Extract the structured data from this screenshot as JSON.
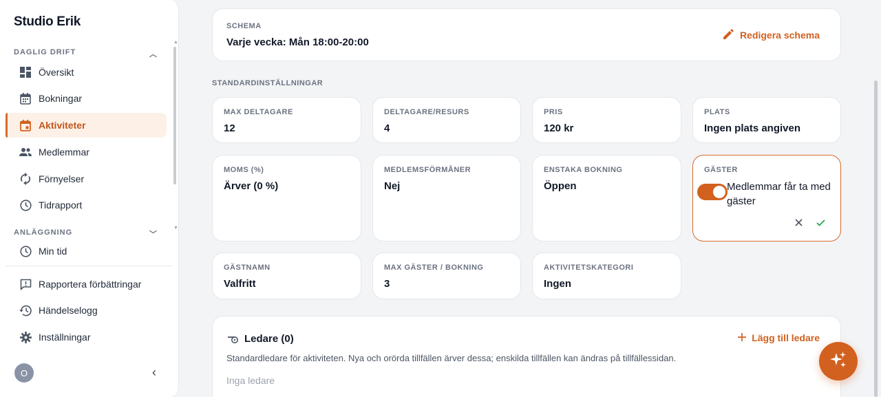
{
  "sidebar": {
    "brand": "Studio Erik",
    "sections": [
      {
        "label": "DAGLIG DRIFT"
      },
      {
        "label": "ANLÄGGNING"
      }
    ],
    "items": [
      {
        "label": "Översikt",
        "icon": "dashboard-icon"
      },
      {
        "label": "Bokningar",
        "icon": "calendar-icon"
      },
      {
        "label": "Aktiviteter",
        "icon": "event-icon",
        "active": true
      },
      {
        "label": "Medlemmar",
        "icon": "people-icon"
      },
      {
        "label": "Förnyelser",
        "icon": "refresh-icon"
      },
      {
        "label": "Tidrapport",
        "icon": "clock-icon"
      }
    ],
    "bottom_items": [
      {
        "label": "Min tid",
        "icon": "clock-icon"
      },
      {
        "label": "Rapportera förbättringar",
        "icon": "feedback-icon"
      },
      {
        "label": "Händelselogg",
        "icon": "history-icon"
      },
      {
        "label": "Inställningar",
        "icon": "gear-icon"
      }
    ],
    "avatar_initial": "O"
  },
  "schema": {
    "label": "SCHEMA",
    "value": "Varje vecka: Mån 18:00-20:00",
    "edit_label": "Redigera schema"
  },
  "defaults": {
    "title": "STANDARDINSTÄLLNINGAR",
    "tiles": [
      {
        "label": "MAX DELTAGARE",
        "value": "12"
      },
      {
        "label": "DELTAGARE/RESURS",
        "value": "4"
      },
      {
        "label": "PRIS",
        "value": "120 kr"
      },
      {
        "label": "PLATS",
        "value": "Ingen plats angiven"
      },
      {
        "label": "MOMS (%)",
        "value": "Ärver (0 %)"
      },
      {
        "label": "MEDLEMSFÖRMÅNER",
        "value": "Nej"
      },
      {
        "label": "ENSTAKA BOKNING",
        "value": "Öppen"
      },
      {
        "label": "GÄSTNAMN",
        "value": "Valfritt"
      },
      {
        "label": "MAX GÄSTER / BOKNING",
        "value": "3"
      },
      {
        "label": "AKTIVITETSKATEGORI",
        "value": "Ingen"
      }
    ],
    "guests": {
      "label": "GÄSTER",
      "toggle_text": "Medlemmar får ta med gäster",
      "toggle_on": true
    }
  },
  "leaders": {
    "title": "Ledare (0)",
    "add_label": "Lägg till ledare",
    "description": "Standardledare för aktiviteten. Nya och orörda tillfällen ärver dessa; enskilda tillfällen kan ändras på tillfällessidan.",
    "empty": "Inga ledare"
  },
  "colors": {
    "accent": "#d2601f",
    "active_bg": "#fdf1e7"
  }
}
